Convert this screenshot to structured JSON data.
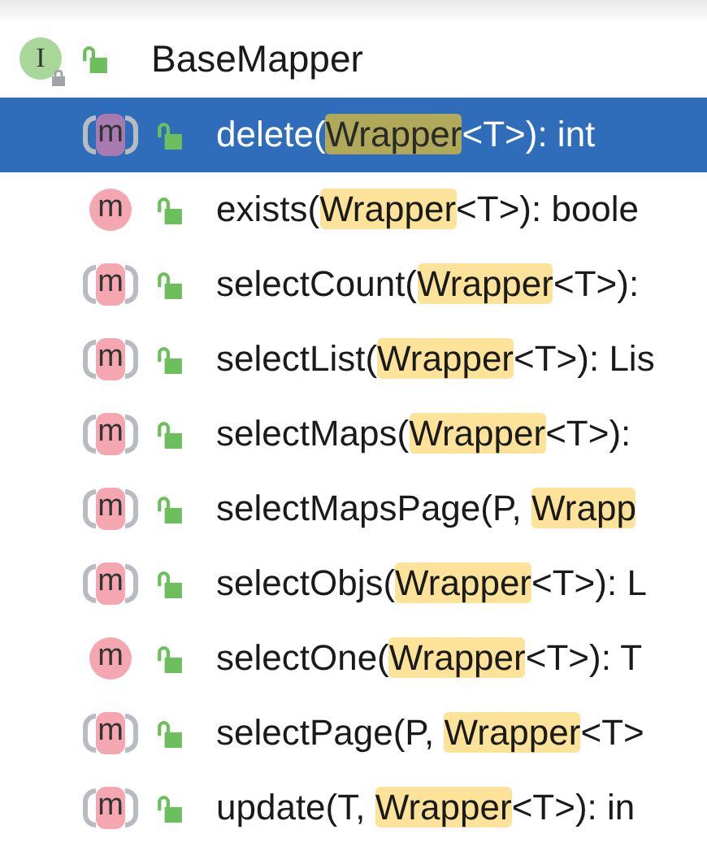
{
  "header": {
    "icon_letter": "I",
    "title": "BaseMapper"
  },
  "methods": [
    {
      "icon_letter": "m",
      "abstract": true,
      "selected": true,
      "parts": [
        {
          "text": "delete(",
          "highlight": false
        },
        {
          "text": "Wrapper",
          "highlight": true
        },
        {
          "text": "<T>): int",
          "highlight": false
        }
      ]
    },
    {
      "icon_letter": "m",
      "abstract": false,
      "selected": false,
      "parts": [
        {
          "text": "exists(",
          "highlight": false
        },
        {
          "text": "Wrapper",
          "highlight": true
        },
        {
          "text": "<T>): boole",
          "highlight": false
        }
      ]
    },
    {
      "icon_letter": "m",
      "abstract": true,
      "selected": false,
      "parts": [
        {
          "text": "selectCount(",
          "highlight": false
        },
        {
          "text": "Wrapper",
          "highlight": true
        },
        {
          "text": "<T>):",
          "highlight": false
        }
      ]
    },
    {
      "icon_letter": "m",
      "abstract": true,
      "selected": false,
      "parts": [
        {
          "text": "selectList(",
          "highlight": false
        },
        {
          "text": "Wrapper",
          "highlight": true
        },
        {
          "text": "<T>): Lis",
          "highlight": false
        }
      ]
    },
    {
      "icon_letter": "m",
      "abstract": true,
      "selected": false,
      "parts": [
        {
          "text": "selectMaps(",
          "highlight": false
        },
        {
          "text": "Wrapper",
          "highlight": true
        },
        {
          "text": "<T>):",
          "highlight": false
        }
      ]
    },
    {
      "icon_letter": "m",
      "abstract": true,
      "selected": false,
      "parts": [
        {
          "text": "selectMapsPage(P, ",
          "highlight": false
        },
        {
          "text": "Wrapp",
          "highlight": true
        }
      ]
    },
    {
      "icon_letter": "m",
      "abstract": true,
      "selected": false,
      "parts": [
        {
          "text": "selectObjs(",
          "highlight": false
        },
        {
          "text": "Wrapper",
          "highlight": true
        },
        {
          "text": "<T>): L",
          "highlight": false
        }
      ]
    },
    {
      "icon_letter": "m",
      "abstract": false,
      "selected": false,
      "parts": [
        {
          "text": "selectOne(",
          "highlight": false
        },
        {
          "text": "Wrapper",
          "highlight": true
        },
        {
          "text": "<T>): T",
          "highlight": false
        }
      ]
    },
    {
      "icon_letter": "m",
      "abstract": true,
      "selected": false,
      "parts": [
        {
          "text": "selectPage(P, ",
          "highlight": false
        },
        {
          "text": "Wrapper",
          "highlight": true
        },
        {
          "text": "<T>",
          "highlight": false
        }
      ]
    },
    {
      "icon_letter": "m",
      "abstract": true,
      "selected": false,
      "parts": [
        {
          "text": "update(T, ",
          "highlight": false
        },
        {
          "text": "Wrapper",
          "highlight": true
        },
        {
          "text": "<T>): in",
          "highlight": false
        }
      ]
    }
  ]
}
